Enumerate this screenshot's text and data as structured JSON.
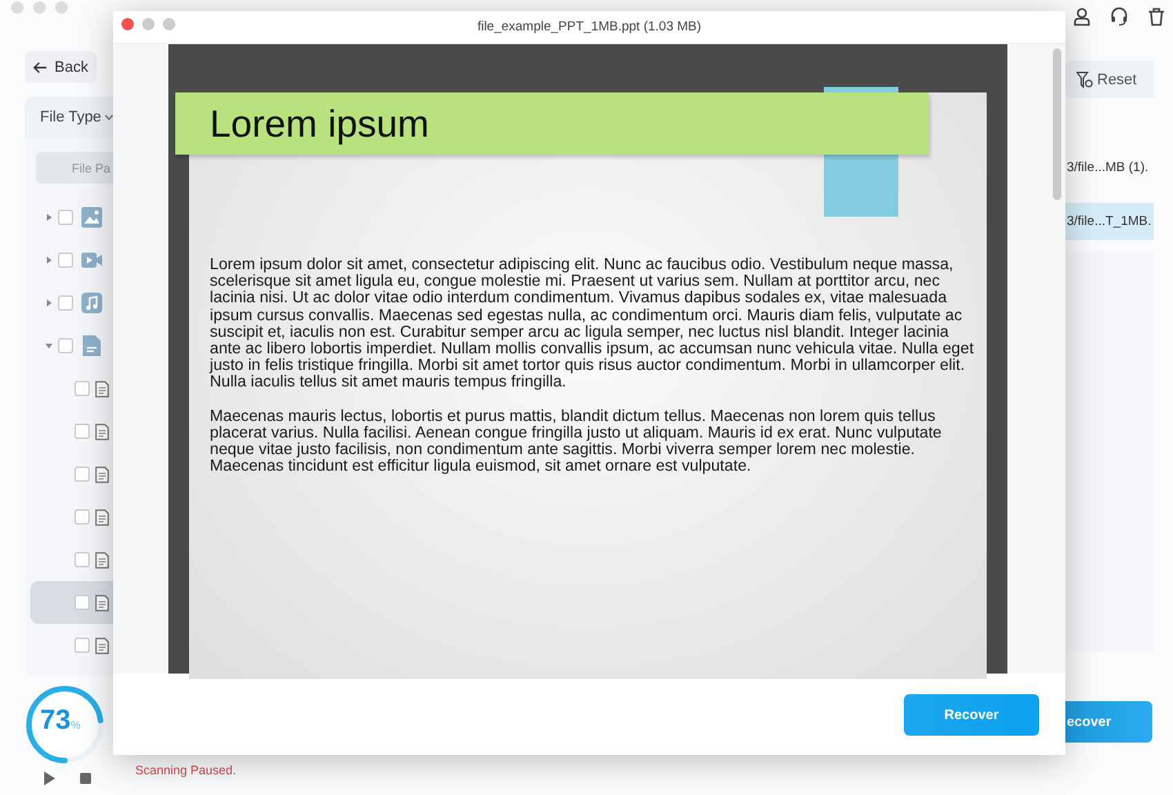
{
  "app": {
    "back_label": "Back",
    "sidebar": {
      "filter_label": "File Type",
      "file_path_tab": "File Pa",
      "categories": [
        {
          "kind": "image",
          "expanded": false,
          "checked": false
        },
        {
          "kind": "video",
          "expanded": false,
          "checked": false
        },
        {
          "kind": "audio",
          "expanded": false,
          "checked": false
        },
        {
          "kind": "document",
          "expanded": true,
          "checked": false,
          "children": [
            {
              "checked": false,
              "selected": false
            },
            {
              "checked": false,
              "selected": false
            },
            {
              "checked": false,
              "selected": false
            },
            {
              "checked": false,
              "selected": false
            },
            {
              "checked": false,
              "selected": false
            },
            {
              "checked": false,
              "selected": true
            },
            {
              "checked": false,
              "selected": false
            }
          ]
        }
      ]
    },
    "reset_label": "Reset",
    "results": [
      {
        "path": "3/file...MB (1).",
        "selected": false
      },
      {
        "path": "3/file...T_1MB.",
        "selected": true
      }
    ],
    "progress": {
      "level": 0.73,
      "value": "73",
      "unit": "%"
    },
    "status": "Scanning Paused.",
    "recover_label": "ecover"
  },
  "preview": {
    "title": "file_example_PPT_1MB.ppt (1.03 MB)",
    "slide": {
      "heading": "Lorem ipsum",
      "paragraphs": [
        "Lorem ipsum dolor sit amet, consectetur adipiscing elit. Nunc ac faucibus odio. Vestibulum neque massa, scelerisque sit amet ligula eu, congue molestie mi. Praesent ut varius sem. Nullam at porttitor arcu, nec lacinia nisi. Ut ac dolor vitae odio interdum condimentum. Vivamus dapibus sodales ex, vitae malesuada ipsum cursus convallis. Maecenas sed egestas nulla, ac condimentum orci. Mauris diam felis, vulputate ac suscipit et, iaculis non est. Curabitur semper arcu ac ligula semper, nec luctus nisl blandit. Integer lacinia ante ac libero lobortis imperdiet. Nullam mollis convallis ipsum, ac accumsan nunc vehicula vitae. Nulla eget justo in felis tristique fringilla. Morbi sit amet tortor quis risus auctor condimentum. Morbi in ullamcorper elit. Nulla iaculis tellus sit amet mauris tempus fringilla.",
        "Maecenas mauris lectus, lobortis et purus mattis, blandit dictum tellus. Maecenas non lorem quis tellus placerat varius. Nulla facilisi. Aenean congue fringilla justo ut aliquam. Mauris id ex erat. Nunc vulputate neque vitae justo facilisis, non condimentum ante sagittis. Morbi viverra semper lorem nec molestie. Maecenas tincidunt est efficitur ligula euismod, sit amet ornare est vulputate."
      ]
    },
    "recover_button": "Recover"
  }
}
